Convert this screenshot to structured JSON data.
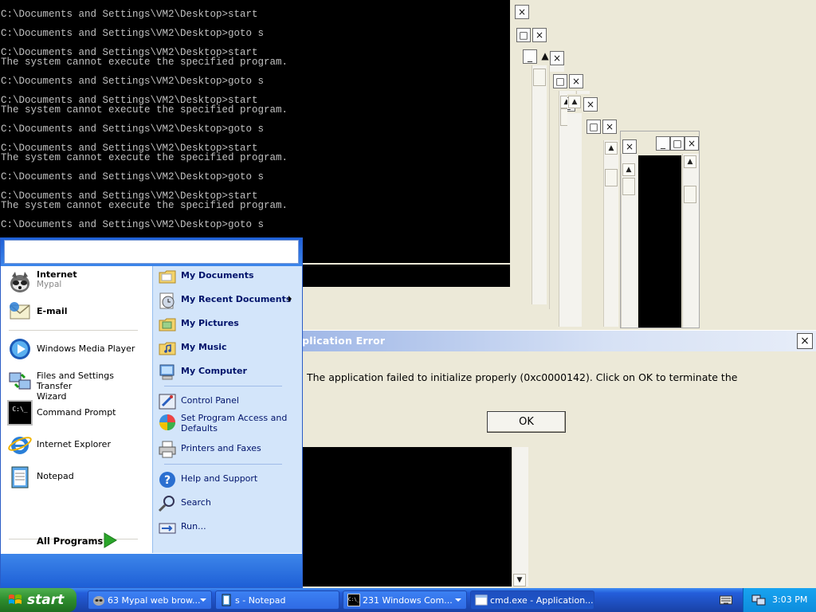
{
  "console": {
    "lines": [
      "C:\\Documents and Settings\\VM2\\Desktop>start",
      "",
      "C:\\Documents and Settings\\VM2\\Desktop>goto s",
      "",
      "C:\\Documents and Settings\\VM2\\Desktop>start",
      "The system cannot execute the specified program.",
      "",
      "C:\\Documents and Settings\\VM2\\Desktop>goto s",
      "",
      "C:\\Documents and Settings\\VM2\\Desktop>start",
      "The system cannot execute the specified program.",
      "",
      "C:\\Documents and Settings\\VM2\\Desktop>goto s",
      "",
      "C:\\Documents and Settings\\VM2\\Desktop>start",
      "The system cannot execute the specified program.",
      "",
      "C:\\Documents and Settings\\VM2\\Desktop>goto s",
      "",
      "C:\\Documents and Settings\\VM2\\Desktop>start",
      "The system cannot execute the specified program.",
      "",
      "C:\\Documents and Settings\\VM2\\Desktop>goto s"
    ]
  },
  "window_buttons": {
    "minimize": "_",
    "maximize": "□",
    "close": "×"
  },
  "scroll_arrows": {
    "up": "▲",
    "down": "▼"
  },
  "error_dialog": {
    "title": "pplication Error",
    "message": "The application failed to initialize properly (0xc0000142). Click on OK to terminate the",
    "ok_label": "OK",
    "close_glyph": "×"
  },
  "start_menu": {
    "pinned": [
      {
        "label": "Internet",
        "sub": "Mypal",
        "icon": "raccoon-browser-icon"
      },
      {
        "label": "E-mail",
        "icon": "email-icon"
      }
    ],
    "recent": [
      {
        "label": "Windows Media Player",
        "icon": "media-player-icon"
      },
      {
        "label": "Files and Settings Transfer",
        "label2": "Wizard",
        "icon": "transfer-wizard-icon"
      },
      {
        "label": "Command Prompt",
        "icon": "command-prompt-icon",
        "icon_text": "C:\\_"
      },
      {
        "label": "Internet Explorer",
        "icon": "internet-explorer-icon"
      },
      {
        "label": "Notepad",
        "icon": "notepad-icon"
      }
    ],
    "all_programs": "All Programs",
    "places": [
      {
        "label": "My Documents",
        "icon": "folder-icon"
      },
      {
        "label": "My Recent Documents",
        "icon": "recent-documents-icon"
      },
      {
        "label": "My Pictures",
        "icon": "pictures-folder-icon"
      },
      {
        "label": "My Music",
        "icon": "music-folder-icon"
      },
      {
        "label": "My Computer",
        "icon": "computer-icon"
      }
    ],
    "settings": [
      {
        "label": "Control Panel",
        "icon": "control-panel-icon"
      },
      {
        "label": "Set Program Access and",
        "label2": "Defaults",
        "icon": "program-access-icon"
      },
      {
        "label": "Printers and Faxes",
        "icon": "printer-icon"
      }
    ],
    "help": [
      {
        "label": "Help and Support",
        "icon": "help-icon"
      },
      {
        "label": "Search",
        "icon": "search-icon"
      },
      {
        "label": "Run...",
        "icon": "run-icon"
      }
    ]
  },
  "taskbar": {
    "start_label": "start",
    "buttons": [
      {
        "label": "63 Mypal web brow...",
        "icon": "raccoon-browser-icon",
        "group": true
      },
      {
        "label": "s - Notepad",
        "icon": "notepad-icon",
        "group": false
      },
      {
        "label": "231 Windows Com...",
        "icon": "command-prompt-icon",
        "group": true
      },
      {
        "label": "cmd.exe - Application...",
        "icon": "window-icon",
        "group": false
      }
    ],
    "clock": "3:03 PM"
  },
  "colors": {
    "xp_blue": "#245edb",
    "start_green": "#2d8c2d",
    "dialog_title_gradient": "#9eb6e6",
    "console_text": "#c0c0c0"
  }
}
